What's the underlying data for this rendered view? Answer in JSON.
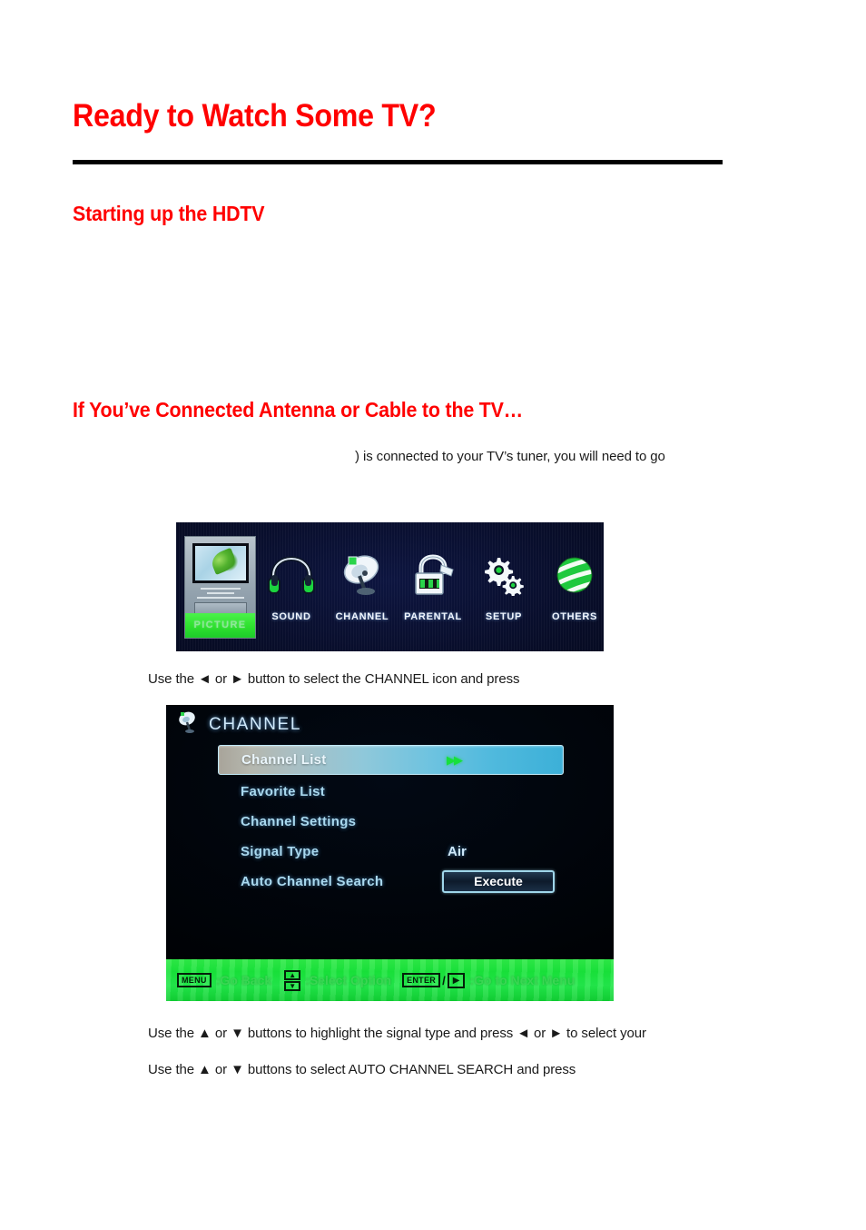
{
  "document": {
    "heading": "Ready to Watch Some TV?",
    "section_startup": "Starting up the HDTV",
    "section_antenna": "If You’ve Connected Antenna or Cable to the TV…",
    "paragraph_tuner": ") is connected to your TV’s tuner, you will need to go",
    "instruction_channel_icon": "Use the ◄ or ► button to select the CHANNEL icon and press",
    "instruction_signal_type": "Use the ▲ or ▼ buttons to highlight the signal type and press ◄ or ► to select your",
    "instruction_auto_search": "Use the ▲ or ▼ buttons to select AUTO CHANNEL SEARCH and press"
  },
  "colors": {
    "heading_red": "#ff0000",
    "rule_black": "#000000",
    "osd_green": "#22e84a",
    "osd_blue_text": "#a9d8ee",
    "arrow_green": "#17e03c"
  },
  "main_menu": {
    "items": [
      {
        "label": "PICTURE",
        "icon": "tv-picture-icon",
        "selected": true
      },
      {
        "label": "SOUND",
        "icon": "headphones-icon",
        "selected": false
      },
      {
        "label": "CHANNEL",
        "icon": "satellite-dish-icon",
        "selected": false
      },
      {
        "label": "PARENTAL",
        "icon": "padlock-icon",
        "selected": false
      },
      {
        "label": "SETUP",
        "icon": "gears-icon",
        "selected": false
      },
      {
        "label": "OTHERS",
        "icon": "globe-icon",
        "selected": false
      }
    ]
  },
  "channel_menu": {
    "title": "CHANNEL",
    "title_icon": "satellite-dish-icon",
    "rows": [
      {
        "label": "Channel List",
        "value": "",
        "selected": true,
        "arrows": "▶▶"
      },
      {
        "label": "Favorite List",
        "value": "",
        "selected": false
      },
      {
        "label": "Channel Settings",
        "value": "",
        "selected": false
      },
      {
        "label": "Signal Type",
        "value": "Air",
        "selected": false
      },
      {
        "label": "Auto Channel Search",
        "value": "Execute",
        "selected": false,
        "button": true
      }
    ],
    "footer": {
      "menu_key": "MENU",
      "menu_action": ":Go Back",
      "updown_up": "▲",
      "updown_down": "▼",
      "updown_action": ":Select Option",
      "enter_key": "ENTER",
      "slash": "/",
      "right_key": "▶",
      "enter_action": ":Go to Next Menu"
    }
  }
}
